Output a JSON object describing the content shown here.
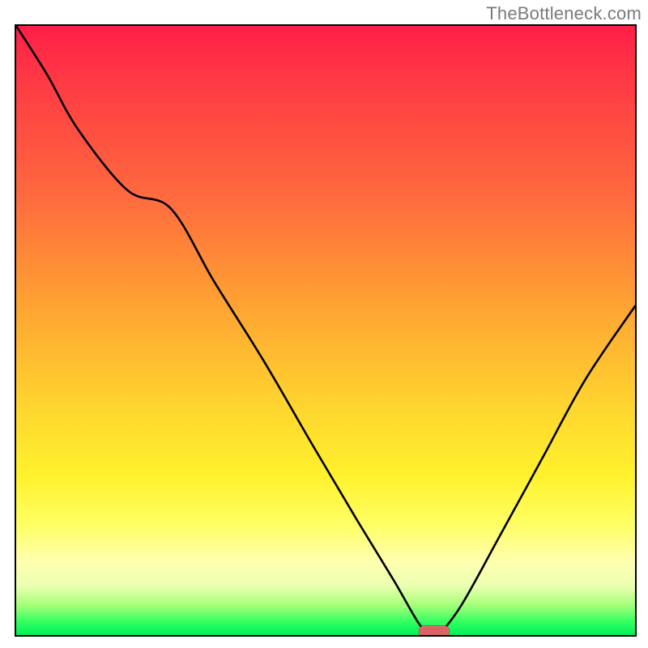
{
  "watermark": {
    "text": "TheBottleneck.com"
  },
  "chart_data": {
    "type": "line",
    "title": "",
    "xlabel": "",
    "ylabel": "",
    "x": [
      0.0,
      0.05,
      0.1,
      0.18,
      0.25,
      0.32,
      0.4,
      0.48,
      0.55,
      0.61,
      0.65,
      0.67,
      0.682,
      0.72,
      0.78,
      0.85,
      0.92,
      1.0
    ],
    "values": [
      1.0,
      0.92,
      0.83,
      0.73,
      0.7,
      0.58,
      0.45,
      0.31,
      0.19,
      0.09,
      0.02,
      0.0,
      0.0,
      0.05,
      0.16,
      0.29,
      0.42,
      0.54
    ],
    "xlim": [
      0,
      1
    ],
    "ylim": [
      0,
      1
    ],
    "marker": {
      "x": 0.674,
      "y": 0.0
    },
    "gradient_bands": [
      {
        "y": 1.0,
        "color": "#ff1f47",
        "label": "red"
      },
      {
        "y": 0.55,
        "color": "#ffa033",
        "label": "orange"
      },
      {
        "y": 0.28,
        "color": "#fff22d",
        "label": "yellow"
      },
      {
        "y": 0.08,
        "color": "#ffffb0",
        "label": "light-yellow"
      },
      {
        "y": 0.0,
        "color": "#00ef58",
        "label": "green"
      }
    ],
    "note": "x and y are normalized to [0,1]; no numeric axis labels are visible in the image"
  }
}
